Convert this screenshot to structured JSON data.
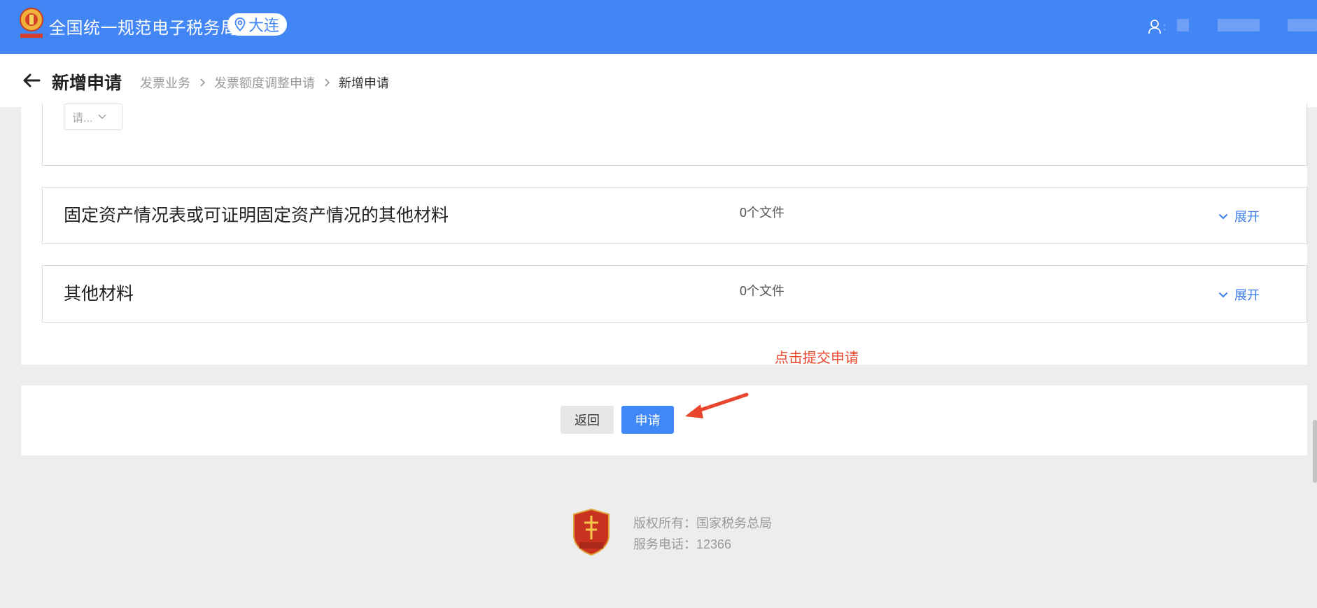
{
  "topbar": {
    "site_title": "全国统一规范电子税务局",
    "region": "大连",
    "user_colon": ":",
    "brand_color": "#4285f4"
  },
  "subheader": {
    "page_title": "新增申请",
    "breadcrumb": [
      "发票业务",
      "发票额度调整申请",
      "新增申请"
    ]
  },
  "form": {
    "select_placeholder": "请..."
  },
  "materials": [
    {
      "title": "固定资产情况表或可证明固定资产情况的其他材料",
      "count": "0个文件",
      "toggle": "展开"
    },
    {
      "title": "其他材料",
      "count": "0个文件",
      "toggle": "展开"
    }
  ],
  "annotation": {
    "hint": "点击提交申请",
    "color": "#e8452b"
  },
  "actions": {
    "back_label": "返回",
    "apply_label": "申请"
  },
  "footer": {
    "copyright": "版权所有：国家税务总局",
    "phone": "服务电话：12366"
  }
}
